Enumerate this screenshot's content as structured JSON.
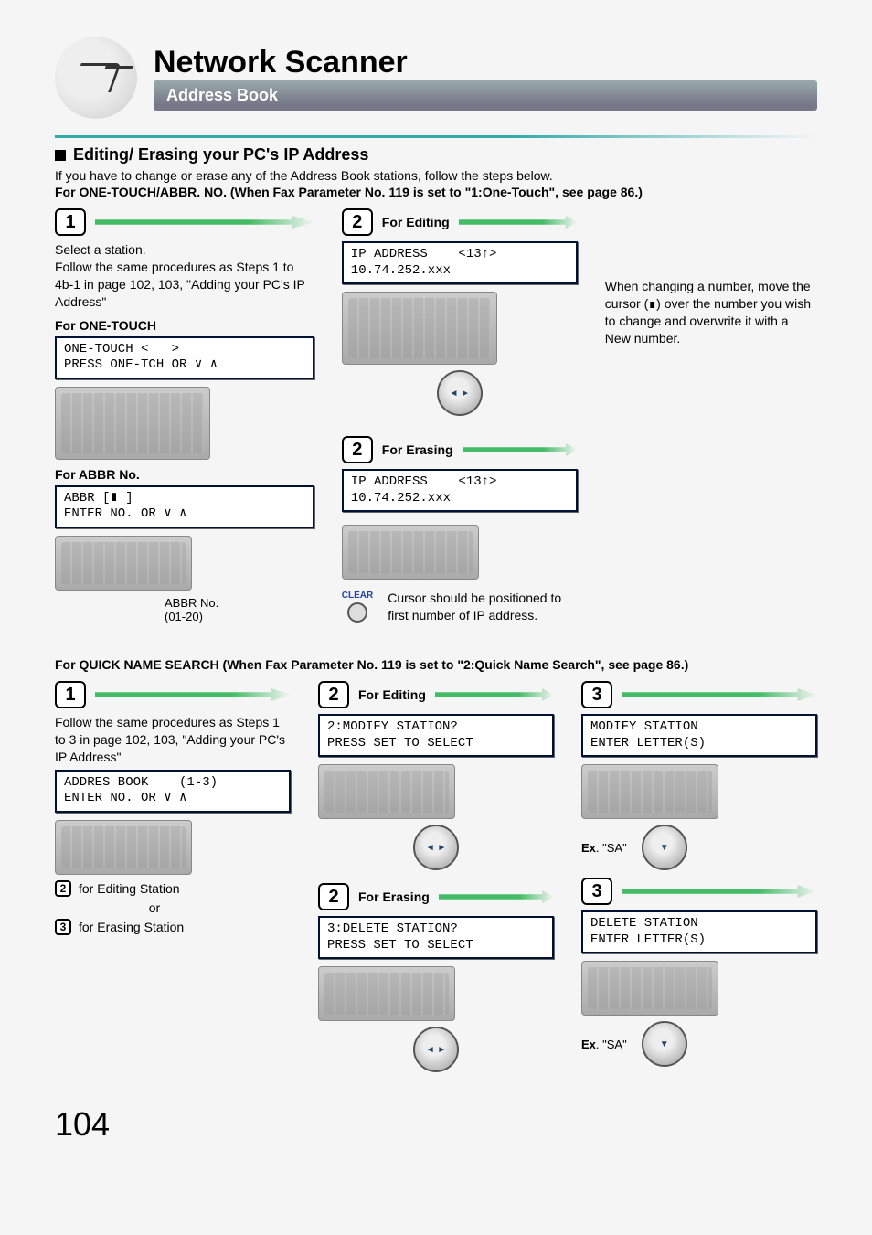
{
  "header": {
    "title": "Network Scanner",
    "subtitle": "Address Book"
  },
  "section": {
    "heading": "Editing/ Erasing your PC's IP Address",
    "intro": "If you have to change or erase any of the Address Book stations, follow the steps below.",
    "note1": "For ONE-TOUCH/ABBR. NO. (When Fax Parameter No. 119 is set to \"1:One-Touch\", see page 86.)"
  },
  "flow1": {
    "step1": {
      "num": "1",
      "text": "Select a station.\nFollow the same procedures as Steps 1 to 4b-1 in page 102, 103, \"Adding your PC's IP Address\"",
      "onetouch_label": "For ONE-TOUCH",
      "onetouch_lcd": "ONE-TOUCH <   >\nPRESS ONE-TCH OR ∨ ∧",
      "abbr_label": "For ABBR No.",
      "abbr_lcd": "ABBR [∎ ]\nENTER NO. OR ∨ ∧",
      "abbr_caption": "ABBR No.\n(01-20)"
    },
    "step2edit": {
      "num": "2",
      "label": "For Editing",
      "lcd": "IP ADDRESS    <13↑>\n10.74.252.xxx",
      "sidetext": "When changing a number, move the cursor (∎) over the number you wish to change and overwrite it with a New number."
    },
    "step2erase": {
      "num": "2",
      "label": "For Erasing",
      "lcd": "IP ADDRESS    <13↑>\n10.74.252.xxx",
      "clear_label": "CLEAR",
      "sidetext": "Cursor should be positioned to first number of IP address."
    }
  },
  "note2": "For QUICK NAME SEARCH (When Fax Parameter No. 119 is set to \"2:Quick Name Search\", see page 86.)",
  "flow2": {
    "step1": {
      "num": "1",
      "text": "Follow the same procedures as Steps 1 to 3 in page 102, 103, \"Adding your PC's IP Address\"",
      "lcd": "ADDRES BOOK    (1-3)\nENTER NO. OR ∨ ∧",
      "badge2": "2",
      "edit_label": "for Editing Station",
      "or": "or",
      "badge3": "3",
      "erase_label": "for Erasing Station"
    },
    "step2edit": {
      "num": "2",
      "label": "For Editing",
      "lcd": "2:MODIFY STATION?\nPRESS SET TO SELECT"
    },
    "step2erase": {
      "num": "2",
      "label": "For Erasing",
      "lcd": "3:DELETE STATION?\nPRESS SET TO SELECT"
    },
    "step3edit": {
      "num": "3",
      "lcd": "MODIFY STATION\nENTER LETTER(S)",
      "ex_prefix": "Ex",
      "ex_text": ". \"SA\""
    },
    "step3erase": {
      "num": "3",
      "lcd": "DELETE STATION\nENTER LETTER(S)",
      "ex_prefix": "Ex",
      "ex_text": ". \"SA\""
    }
  },
  "page_number": "104"
}
